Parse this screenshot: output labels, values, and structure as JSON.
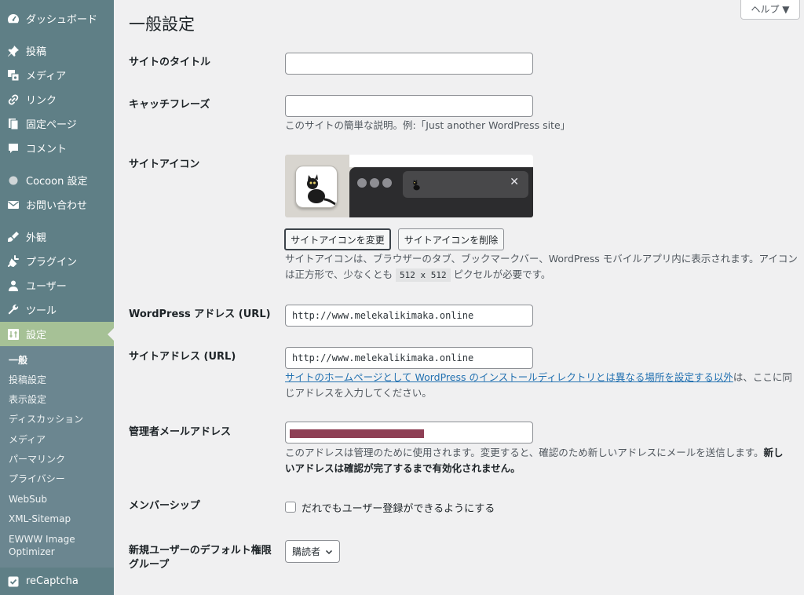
{
  "sidebar": {
    "menu": [
      {
        "label": "ダッシュボード",
        "icon": "dashboard-icon"
      },
      {
        "label": "投稿",
        "icon": "pin-icon"
      },
      {
        "label": "メディア",
        "icon": "media-icon"
      },
      {
        "label": "リンク",
        "icon": "link-icon"
      },
      {
        "label": "固定ページ",
        "icon": "pages-icon"
      },
      {
        "label": "コメント",
        "icon": "comment-icon"
      },
      {
        "label": "Cocoon 設定",
        "icon": "cocoon-icon"
      },
      {
        "label": "お問い合わせ",
        "icon": "mail-icon"
      },
      {
        "label": "外観",
        "icon": "appearance-icon"
      },
      {
        "label": "プラグイン",
        "icon": "plugin-icon"
      },
      {
        "label": "ユーザー",
        "icon": "user-icon"
      },
      {
        "label": "ツール",
        "icon": "tools-icon"
      },
      {
        "label": "設定",
        "icon": "settings-icon"
      }
    ],
    "submenu": [
      "一般",
      "投稿設定",
      "表示設定",
      "ディスカッション",
      "メディア",
      "パーマリンク",
      "プライバシー",
      "WebSub",
      "XML-Sitemap",
      "EWWW Image",
      "Optimizer"
    ],
    "bottom_item": {
      "label": "reCaptcha",
      "icon": "checkbox-icon"
    }
  },
  "help_button": "ヘルプ ▼",
  "page_title": "一般設定",
  "fields": {
    "site_title": {
      "label": "サイトのタイトル",
      "value": ""
    },
    "tagline": {
      "label": "キャッチフレーズ",
      "value": "",
      "description": "このサイトの簡単な説明。例:「Just another WordPress site」"
    },
    "site_icon": {
      "label": "サイトアイコン",
      "change_button": "サイトアイコンを変更",
      "remove_button": "サイトアイコンを削除",
      "description_1": "サイトアイコンは、ブラウザーのタブ、ブックマークバー、WordPress モバイルアプリ内に表示されます。アイコン",
      "description_2a": "は正方形で、少なくとも",
      "description_code": "512 x 512",
      "description_2b": "ピクセルが必要です。"
    },
    "wp_address": {
      "label": "WordPress アドレス (URL)",
      "value": "http://www.melekalikimaka.online"
    },
    "site_address": {
      "label": "サイトアドレス (URL)",
      "value": "http://www.melekalikimaka.online",
      "link_text": "サイトのホームページとして WordPress のインストールディレクトリとは異なる場所を設定する以外",
      "desc_after_link": "は、ここに同",
      "desc_line2": "じアドレスを入力してください。"
    },
    "admin_email": {
      "label": "管理者メールアドレス",
      "desc_1": "このアドレスは管理のために使用されます。変更すると、確認のため新しいアドレスにメールを送信します。",
      "desc_bold_1": "新し",
      "desc_bold_2": "いアドレスは確認が完了するまで有効化されません。"
    },
    "membership": {
      "label": "メンバーシップ",
      "checkbox_label": "だれでもユーザー登録ができるようにする",
      "checked": false
    },
    "default_role": {
      "label_1": "新規ユーザーのデフォルト権限",
      "label_2": "グループ",
      "selected": "購読者"
    }
  },
  "colors": {
    "sidebar": "#5f7f86",
    "current_menu": "#a6c196",
    "link": "#2271b1",
    "redaction": "#8e3f55"
  }
}
